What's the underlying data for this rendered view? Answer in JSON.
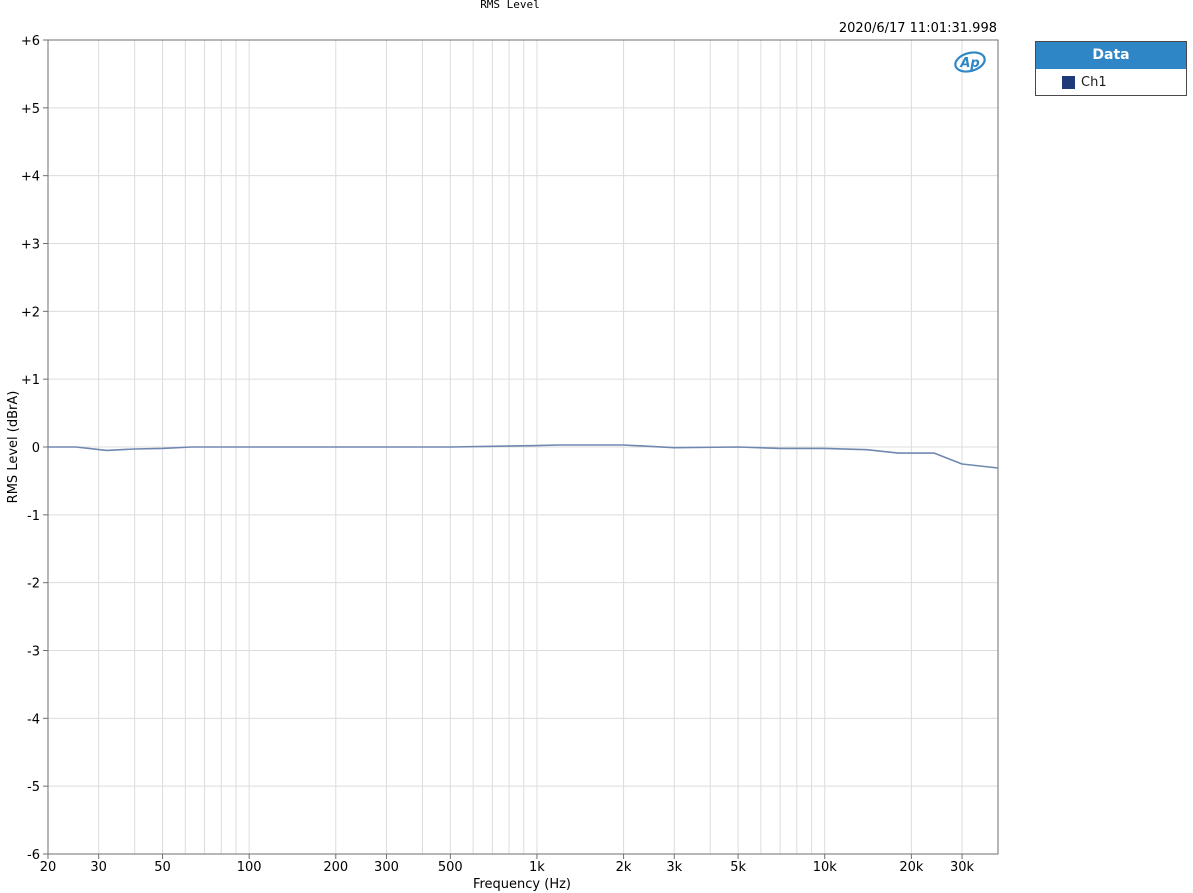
{
  "chart_data": {
    "type": "line",
    "title": "RMS Level",
    "timestamp": "2020/6/17 11:01:31.998",
    "xlabel": "Frequency (Hz)",
    "ylabel": "RMS Level (dBrA)",
    "x_scale": "log",
    "xlim": [
      20,
      40000
    ],
    "ylim": [
      -6,
      6
    ],
    "grid": true,
    "x_ticks": [
      {
        "value": 20,
        "label": "20"
      },
      {
        "value": 30,
        "label": "30"
      },
      {
        "value": 50,
        "label": "50"
      },
      {
        "value": 100,
        "label": "100"
      },
      {
        "value": 200,
        "label": "200"
      },
      {
        "value": 300,
        "label": "300"
      },
      {
        "value": 500,
        "label": "500"
      },
      {
        "value": 1000,
        "label": "1k"
      },
      {
        "value": 2000,
        "label": "2k"
      },
      {
        "value": 3000,
        "label": "3k"
      },
      {
        "value": 5000,
        "label": "5k"
      },
      {
        "value": 10000,
        "label": "10k"
      },
      {
        "value": 20000,
        "label": "20k"
      },
      {
        "value": 30000,
        "label": "30k"
      }
    ],
    "y_ticks": [
      {
        "value": 6,
        "label": "+6"
      },
      {
        "value": 5,
        "label": "+5"
      },
      {
        "value": 4,
        "label": "+4"
      },
      {
        "value": 3,
        "label": "+3"
      },
      {
        "value": 2,
        "label": "+2"
      },
      {
        "value": 1,
        "label": "+1"
      },
      {
        "value": 0,
        "label": "0"
      },
      {
        "value": -1,
        "label": "-1"
      },
      {
        "value": -2,
        "label": "-2"
      },
      {
        "value": -3,
        "label": "-3"
      },
      {
        "value": -4,
        "label": "-4"
      },
      {
        "value": -5,
        "label": "-5"
      },
      {
        "value": -6,
        "label": "-6"
      }
    ],
    "legend": {
      "title": "Data",
      "placement": "right"
    },
    "series": [
      {
        "name": "Ch1",
        "color": "#7088b0",
        "swatch_color": "#1f3a78",
        "x": [
          20,
          25,
          32,
          40,
          50,
          63,
          100,
          200,
          300,
          500,
          700,
          1000,
          1200,
          2000,
          3000,
          5000,
          7000,
          10000,
          14000,
          18000,
          24000,
          30000,
          40000
        ],
        "y": [
          0.0,
          0.0,
          -0.05,
          -0.03,
          -0.02,
          0.0,
          0.0,
          0.0,
          0.0,
          0.0,
          0.01,
          0.02,
          0.03,
          0.03,
          -0.01,
          0.0,
          -0.02,
          -0.02,
          -0.04,
          -0.09,
          -0.09,
          -0.25,
          -0.31
        ]
      }
    ]
  },
  "colors": {
    "grid": "#dcdcdc",
    "frame": "#6f6f6f",
    "legend_header": "#2f86c6",
    "logo": "#2f86c6"
  },
  "logo": {
    "icon": "ap-logo-icon",
    "text": "Ap"
  }
}
